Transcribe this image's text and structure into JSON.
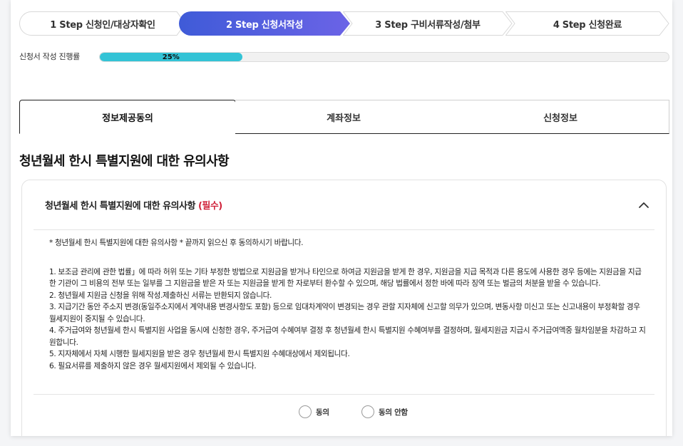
{
  "steps": [
    {
      "label": "1 Step 신청인/대상자확인",
      "active": false
    },
    {
      "label": "2 Step 신청서작성",
      "active": true
    },
    {
      "label": "3 Step 구비서류작성/첨부",
      "active": false
    },
    {
      "label": "4 Step 신청완료",
      "active": false
    }
  ],
  "progress": {
    "label": "신청서 작성 진행률",
    "value_text": "25%",
    "value": 0.25
  },
  "tabs": [
    {
      "label": "정보제공동의",
      "active": true
    },
    {
      "label": "계좌정보",
      "active": false
    },
    {
      "label": "신청정보",
      "active": false
    }
  ],
  "section_title": "청년월세 한시 특별지원에 대한 유의사항",
  "card": {
    "title": "청년월세 한시 특별지원에 대한 유의사항",
    "required": "(필수)",
    "intro": "* 청년월세 한시 특별지원에 대한 유의사항 * 끝까지 읽으신 후 동의하시기 바랍니다.",
    "items": [
      "1. 보조금 관리에 관한 법률」에 따라 허위 또는 기타 부정한 방법으로 지원금을 받거나 타인으로 하여금 지원금을 받게 한 경우, 지원금을 지급 목적과 다른 용도에 사용한 경우 등에는 지원금을 지급한 기관이 그 비용의 전부 또는 일부를 그 지원금을 받은 자 또는 지원금을 받게 한 자로부터 환수할 수 있으며, 해당 법률에서 정한 바에 따라 징역 또는 벌금의 처분을 받을 수 있습니다.",
      "2. 청년월세 지원금 신청을 위해 작성.제출하신 서류는 반환되지 않습니다.",
      "3. 지급기간 동안 주소지 변경(동일주소지에서 계약내용 변경사항도 포함) 등으로 임대차계약이 변경되는 경우 관할 지자체에 신고할 의무가 있으며, 변동사항 미신고 또는 신고내용이 부정확할 경우 월세지원이 중지될 수 있습니다.",
      "4. 주거급여와 청년월세 한시 특별지원 사업을 동시에 신청한 경우, 주거급여 수혜여부 결정 후 청년월세 한시 특별지원 수혜여부를 결정하며, 월세지원금 지급시 주거급여액중 월차임분을 차감하고 지원합니다.",
      "5. 지자체에서 자체 시행한 월세지원을 받은 경우 청년월세 한시 특별지원 수혜대상에서 제외됩니다.",
      "6. 필요서류를 제출하지 않은 경우 월세지원에서 제외될 수 있습니다."
    ],
    "agree_label": "동의",
    "disagree_label": "동의 안함"
  },
  "colors": {
    "active_step_start": "#3f5bd8",
    "active_step_end": "#6b63e6",
    "progress_fill": "#33c3d6",
    "required": "#d0223a"
  }
}
